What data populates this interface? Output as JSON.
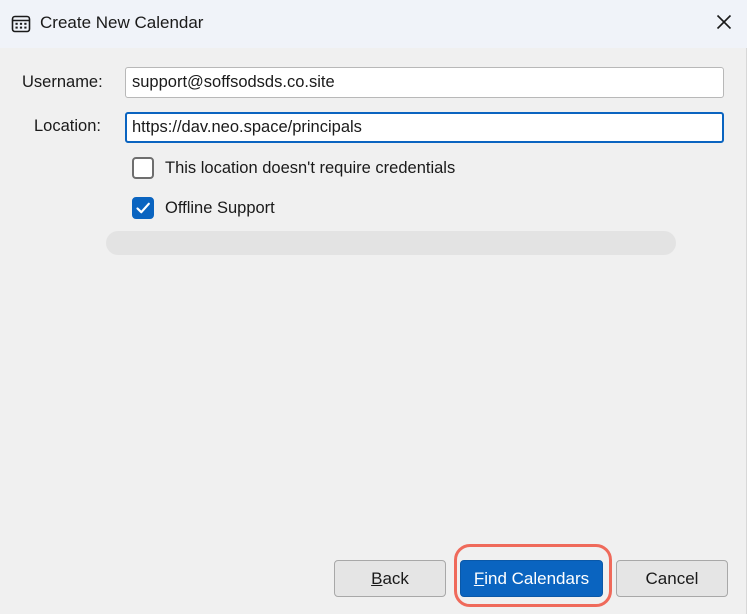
{
  "window": {
    "title": "Create New Calendar",
    "title_icon": "calendar-icon",
    "close_icon": "close-icon"
  },
  "form": {
    "username_label": "Username:",
    "username_value": "support@soffsodsds.co.site",
    "location_label": "Location:",
    "location_value": "https://dav.neo.space/principals",
    "no_credentials_label": "This location doesn't require credentials",
    "no_credentials_checked": false,
    "offline_support_label": "Offline Support",
    "offline_support_checked": true,
    "progress": 0
  },
  "buttons": {
    "back": {
      "mnemonic": "B",
      "rest": "ack"
    },
    "find_calendars": {
      "mnemonic": "F",
      "rest": "ind Calendars"
    },
    "cancel": "Cancel"
  },
  "colors": {
    "accent": "#0a64c0",
    "highlight_ring": "#ef6a5b",
    "background": "#f0f0f0",
    "titlebar": "#f0f3f9"
  }
}
